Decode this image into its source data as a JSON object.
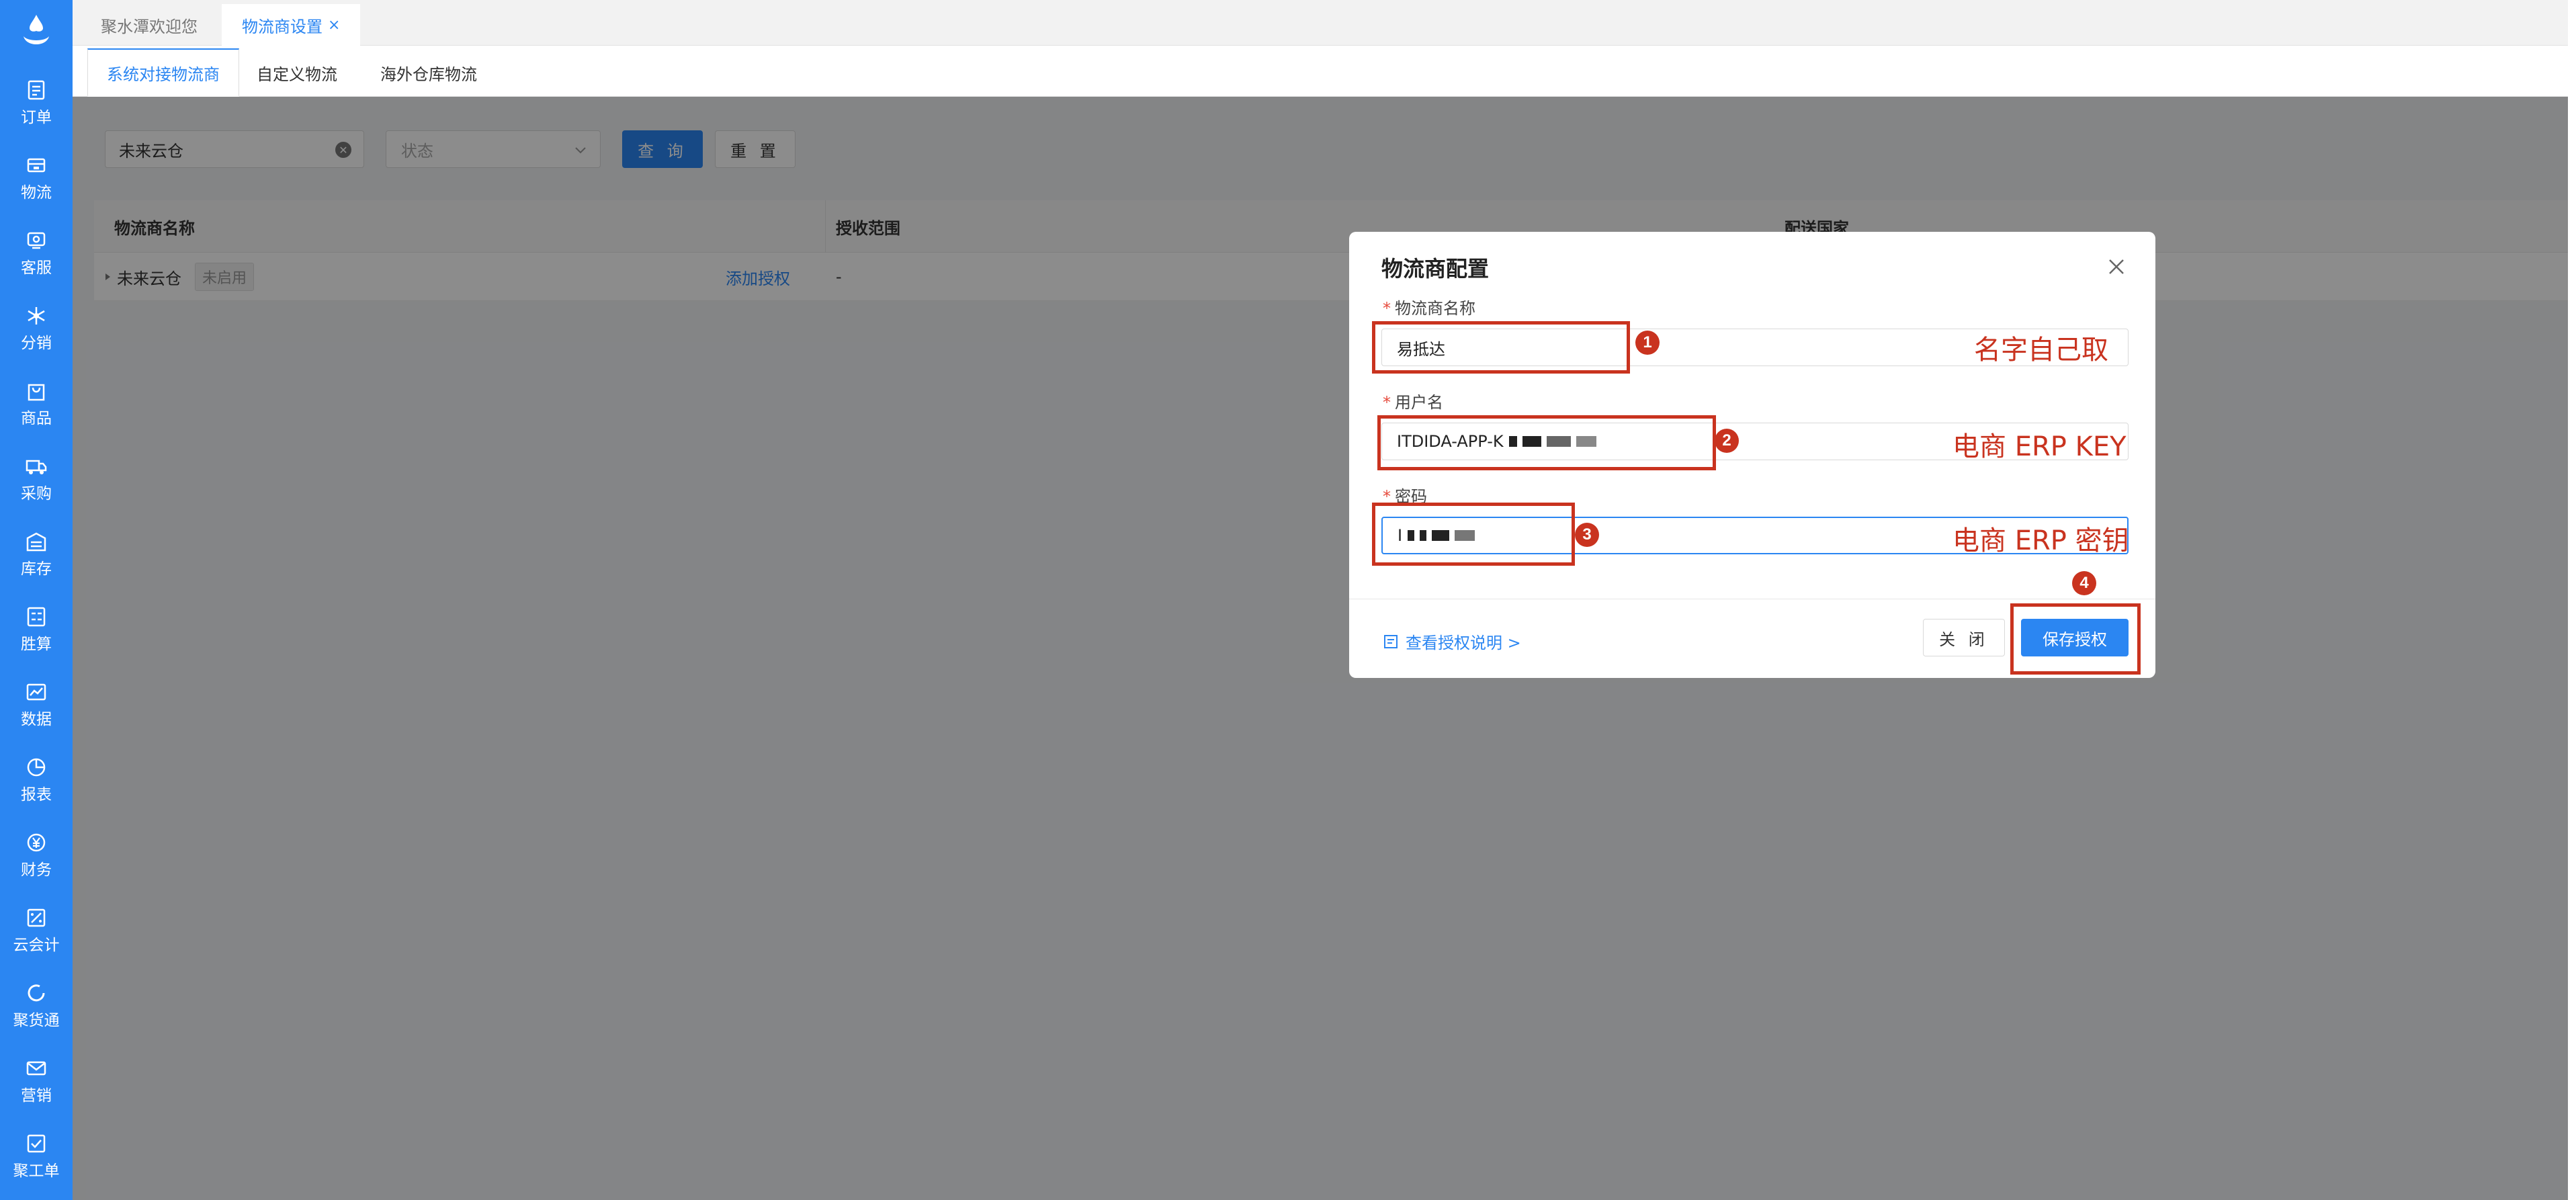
{
  "sidebar": {
    "items": [
      {
        "label": "订单",
        "icon": "order-icon"
      },
      {
        "label": "物流",
        "icon": "truck-box-icon"
      },
      {
        "label": "客服",
        "icon": "customer-service-icon"
      },
      {
        "label": "分销",
        "icon": "distribution-icon"
      },
      {
        "label": "商品",
        "icon": "shopping-bag-icon"
      },
      {
        "label": "采购",
        "icon": "truck-icon"
      },
      {
        "label": "库存",
        "icon": "warehouse-icon"
      },
      {
        "label": "胜算",
        "icon": "calculator-icon"
      },
      {
        "label": "数据",
        "icon": "line-chart-icon"
      },
      {
        "label": "报表",
        "icon": "pie-chart-icon"
      },
      {
        "label": "财务",
        "icon": "yuan-icon"
      },
      {
        "label": "云会计",
        "icon": "accounting-icon"
      },
      {
        "label": "聚货通",
        "icon": "circle-icon"
      },
      {
        "label": "营销",
        "icon": "mail-icon"
      },
      {
        "label": "聚工单",
        "icon": "ticket-icon"
      }
    ]
  },
  "top_tabs": [
    {
      "label": "聚水潭欢迎您"
    },
    {
      "label": "物流商设置",
      "close": "×"
    }
  ],
  "sub_tabs": [
    {
      "label": "系统对接物流商"
    },
    {
      "label": "自定义物流"
    },
    {
      "label": "海外仓库物流"
    }
  ],
  "filters": {
    "search_value": "未来云仓",
    "status_placeholder": "状态",
    "query_label": "查 询",
    "reset_label": "重 置"
  },
  "table": {
    "headers": [
      "物流商名称",
      "授收范围",
      "配送国家"
    ],
    "row": {
      "name": "未来云仓",
      "tag": "未启用",
      "action": "添加授权",
      "range": "-"
    }
  },
  "modal": {
    "title": "物流商配置",
    "fields": [
      {
        "label": "物流商名称",
        "value": "易抵达"
      },
      {
        "label": "用户名",
        "value": "ITDIDA-APP-K"
      },
      {
        "label": "密码",
        "value": "I"
      }
    ],
    "help_link": "查看授权说明 >",
    "close_label": "关 闭",
    "save_label": "保存授权"
  },
  "annotations": [
    {
      "num": "1",
      "note": "名字自己取"
    },
    {
      "num": "2",
      "note": "电商 ERP KEY"
    },
    {
      "num": "3",
      "note": "电商 ERP 密钥"
    },
    {
      "num": "4"
    }
  ],
  "colors": {
    "primary": "#2b86f2",
    "annotation_red": "#c9331f",
    "required_red": "#e64a3c"
  }
}
